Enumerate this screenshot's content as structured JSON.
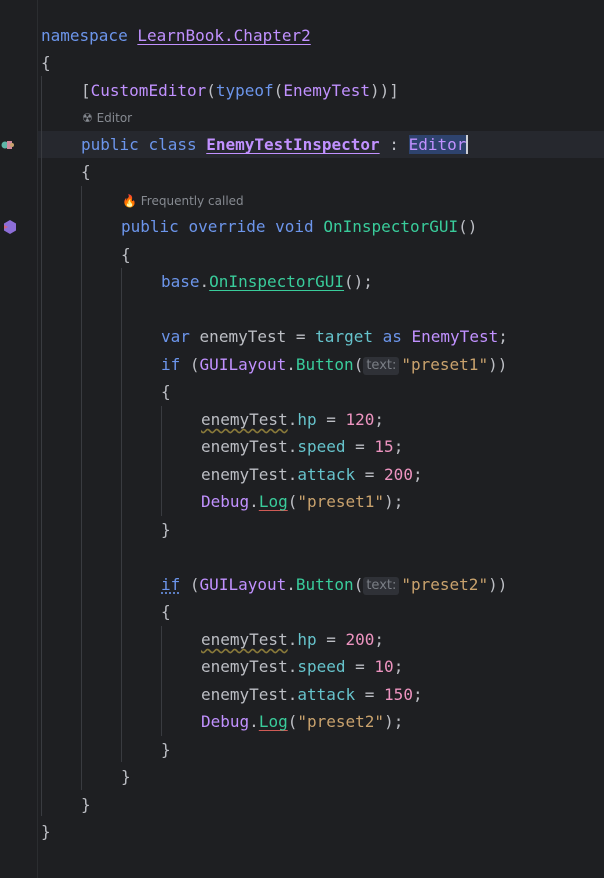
{
  "hints": {
    "editor_usage": "Editor",
    "frequently_called": "Frequently called"
  },
  "inlay": {
    "param1": "text:",
    "param2": "text:"
  },
  "code": {
    "l1": {
      "kw": "namespace",
      "ns": "LearnBook.Chapter2"
    },
    "l2": "{",
    "l3": {
      "open": "[",
      "attr": "CustomEditor",
      "p1": "(",
      "kw": "typeof",
      "p2": "(",
      "ty": "EnemyTest",
      "close": "))]"
    },
    "l4": {
      "kw1": "public",
      "kw2": "class",
      "cls": "EnemyTestInspector",
      "colon": ":",
      "base": "Editor"
    },
    "l5": "{",
    "l6": {
      "kw1": "public",
      "kw2": "override",
      "kw3": "void",
      "fn": "OnInspectorGUI",
      "paren": "()"
    },
    "l7": "{",
    "l8": {
      "kw": "base",
      "dot": ".",
      "fn": "OnInspectorGUI",
      "end": "();"
    },
    "l9": {
      "kw": "var",
      "id": "enemyTest",
      "eq": "=",
      "kw2": "target",
      "kw3": "as",
      "ty": "EnemyTest",
      "semi": ";"
    },
    "l10": {
      "kw": "if",
      "open": "(",
      "ty": "GUILayout",
      "dot": ".",
      "fn": "Button",
      "p": "(",
      "str": "\"preset1\"",
      "close": "))"
    },
    "l11": "{",
    "l12": {
      "id": "enemyTest",
      "mem": "hp",
      "num": "120"
    },
    "l13": {
      "id": "enemyTest",
      "mem": "speed",
      "num": "15"
    },
    "l14": {
      "id": "enemyTest",
      "mem": "attack",
      "num": "200"
    },
    "l15": {
      "ty": "Debug",
      "fn": "Log",
      "str": "\"preset1\""
    },
    "l16": "}",
    "l17": {
      "kw": "if",
      "open": "(",
      "ty": "GUILayout",
      "dot": ".",
      "fn": "Button",
      "p": "(",
      "str": "\"preset2\"",
      "close": "))"
    },
    "l18": "{",
    "l19": {
      "id": "enemyTest",
      "mem": "hp",
      "num": "200"
    },
    "l20": {
      "id": "enemyTest",
      "mem": "speed",
      "num": "10"
    },
    "l21": {
      "id": "enemyTest",
      "mem": "attack",
      "num": "150"
    },
    "l22": {
      "ty": "Debug",
      "fn": "Log",
      "str": "\"preset2\""
    },
    "l23": "}",
    "l24": "}",
    "l25": "}",
    "l26": "}"
  },
  "icons": {
    "gutter1": "unity-inspector-icon",
    "gutter2": "override-method-icon",
    "editor_hint": "unity-icon",
    "freq_hint": "flame-icon"
  },
  "colors": {
    "background": "#1e1f22",
    "keyword": "#cf8e6d",
    "keyword_blue": "#6c95eb",
    "type": "#c191ff",
    "method": "#39cc9b",
    "member": "#66c3cc",
    "number": "#ed94c0",
    "string": "#c9a26d"
  }
}
